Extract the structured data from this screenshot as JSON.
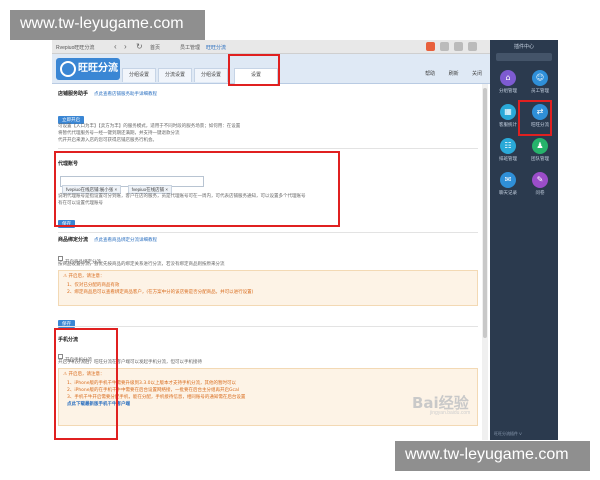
{
  "watermark": {
    "top": "www.tw-leyugame.com",
    "bottom": "www.tw-leyugame.com"
  },
  "window": {
    "title": "Rvepiuo旺旺分流",
    "nav_tabs": [
      "首页",
      "员工管理",
      "旺旺分流"
    ],
    "app_logo": "旺旺分流",
    "tabs": [
      "分组设置",
      "分流设置",
      "分组设置",
      "设置"
    ],
    "header_right": [
      "帮助",
      "刷新",
      "关闭"
    ]
  },
  "section_auto_reply": {
    "title": "店铺服务助手",
    "hint": "点此查看店铺服务助手详细教程",
    "button": "立即开启",
    "lines": [
      "可设置【入口为丰】【卖方为丰】的服务模式，适用于不同时段的服务场景；如何用：在设置",
      "将暂代代理服务号一经一键到期还满期，并支持一键退款分流",
      "代开开启来源入店的您可获得店铺店服务行机会。"
    ]
  },
  "section_proxy": {
    "title": "代理账号",
    "chips": [
      "fvepiuo在线店铺:展小张",
      "fvepiuo在线店铺"
    ],
    "desc": [
      "说明代理账号是指设置可分到账，客户在店的服务，员是代理账号可在一周内，可代表店铺服务通知，可以设置多个代理账号",
      "有在可以设置代理账号"
    ],
    "button": "保存"
  },
  "section_goods": {
    "title": "商品绑定分流",
    "hint": "点此查看商品绑定分流详细教程",
    "toggle": "开启商品绑定分流",
    "desc": "按商品设置分流，会优先按商品的绑定关系进行分流，若没有绑定商品则按原来分流",
    "notes_title": "开启后，请注意：",
    "notes": [
      "1、仅对已分配的商品有效",
      "2、绑定商品后可以查看绑定商品客户，(在方案中分的该店要是否分配商品，并可以进行设置)"
    ],
    "button": "保存"
  },
  "section_phone": {
    "title": "手机分流",
    "toggle": "开启手机分流",
    "desc": "开启手机分流后，旺旺分流在客户端可以发起手机分流，但可以手机接待",
    "notes_title": "开启后，请注意：",
    "notes": [
      "1、iPhone版的手机千牛需要升级到3.3.0以上版本才支持手机分流，其他的暂时可以",
      "2、iPhone版的在手机千牛中需要在后台设置网络接，一批要在后台主分组再开启Gcal",
      "3、手机千牛开启需要分配手机，能在分配，手机接待信息，相同账号的通知需在后台设置"
    ],
    "link": "点此下载最新版手机千牛客户端",
    "button": "保存"
  },
  "right_panel": {
    "title": "插件中心",
    "items": [
      "分组管理",
      "员工管理",
      "客服统计",
      "旺旺分流",
      "排班管理",
      "团队管理",
      "聊天记录",
      "问卷"
    ],
    "bottom": "旺旺分流插件 V"
  },
  "baidu_watermark": {
    "brand": "Bai经验",
    "url": "jingyan.baidu.com"
  },
  "colors": {
    "accent": "#3a86d4",
    "highlight": "#e02020",
    "panel": "#2b3a4e",
    "warning": "#d86a1a"
  }
}
